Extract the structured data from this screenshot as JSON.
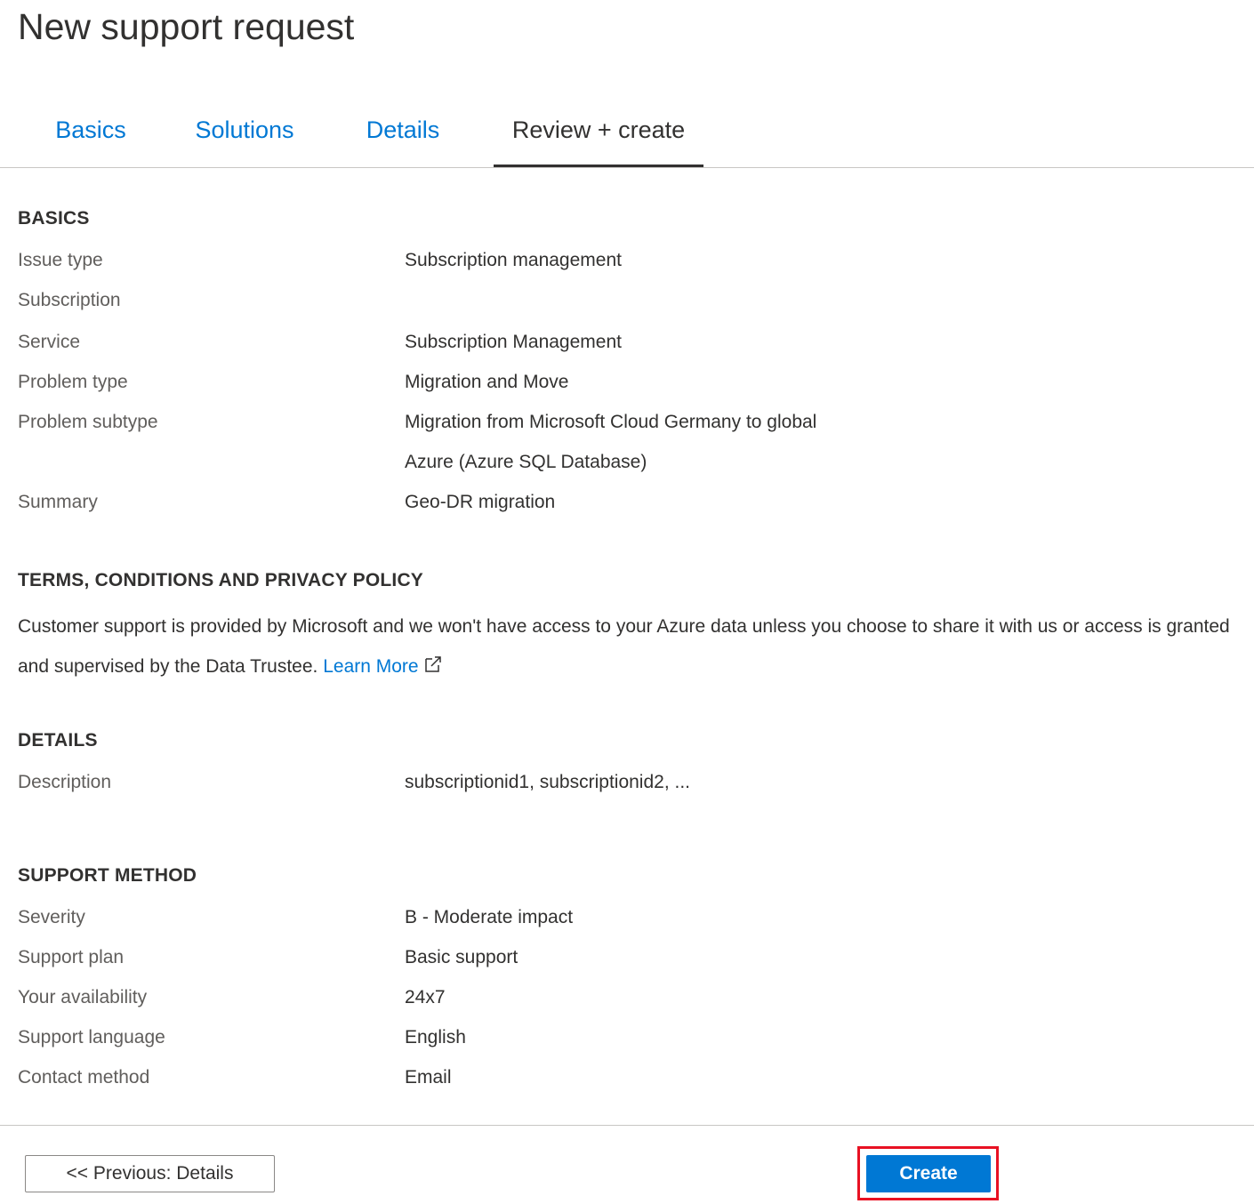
{
  "page": {
    "title": "New support request"
  },
  "tabs": [
    {
      "label": "Basics",
      "active": false
    },
    {
      "label": "Solutions",
      "active": false
    },
    {
      "label": "Details",
      "active": false
    },
    {
      "label": "Review + create",
      "active": true
    }
  ],
  "basics": {
    "heading": "BASICS",
    "rows": [
      {
        "label": "Issue type",
        "value": "Subscription management"
      },
      {
        "label": "Subscription",
        "value": ""
      },
      {
        "label": "Service",
        "value": "Subscription Management"
      },
      {
        "label": "Problem type",
        "value": "Migration and Move"
      },
      {
        "label": "Problem subtype",
        "value": "Migration from Microsoft Cloud Germany to global"
      },
      {
        "label": "",
        "value": "Azure (Azure SQL Database)"
      },
      {
        "label": "Summary",
        "value": "Geo-DR migration"
      }
    ]
  },
  "terms": {
    "heading": "TERMS, CONDITIONS AND PRIVACY POLICY",
    "text": "Customer support is provided by Microsoft and we won't have access to your Azure data unless you choose to share it with us or access is granted and supervised by the Data Trustee.",
    "link_label": "Learn More",
    "link_icon": "external-link-icon"
  },
  "details": {
    "heading": "DETAILS",
    "rows": [
      {
        "label": "Description",
        "value": "subscriptionid1, subscriptionid2, ..."
      }
    ]
  },
  "support_method": {
    "heading": "SUPPORT METHOD",
    "rows": [
      {
        "label": "Severity",
        "value": "B - Moderate impact"
      },
      {
        "label": "Support plan",
        "value": "Basic support"
      },
      {
        "label": "Your availability",
        "value": "24x7"
      },
      {
        "label": "Support language",
        "value": "English"
      },
      {
        "label": "Contact method",
        "value": "Email"
      }
    ]
  },
  "footer": {
    "previous_label": "<< Previous: Details",
    "create_label": "Create"
  },
  "colors": {
    "accent": "#0078d4",
    "highlight": "#e81123",
    "text": "#323130",
    "muted_text": "#605e5c"
  }
}
